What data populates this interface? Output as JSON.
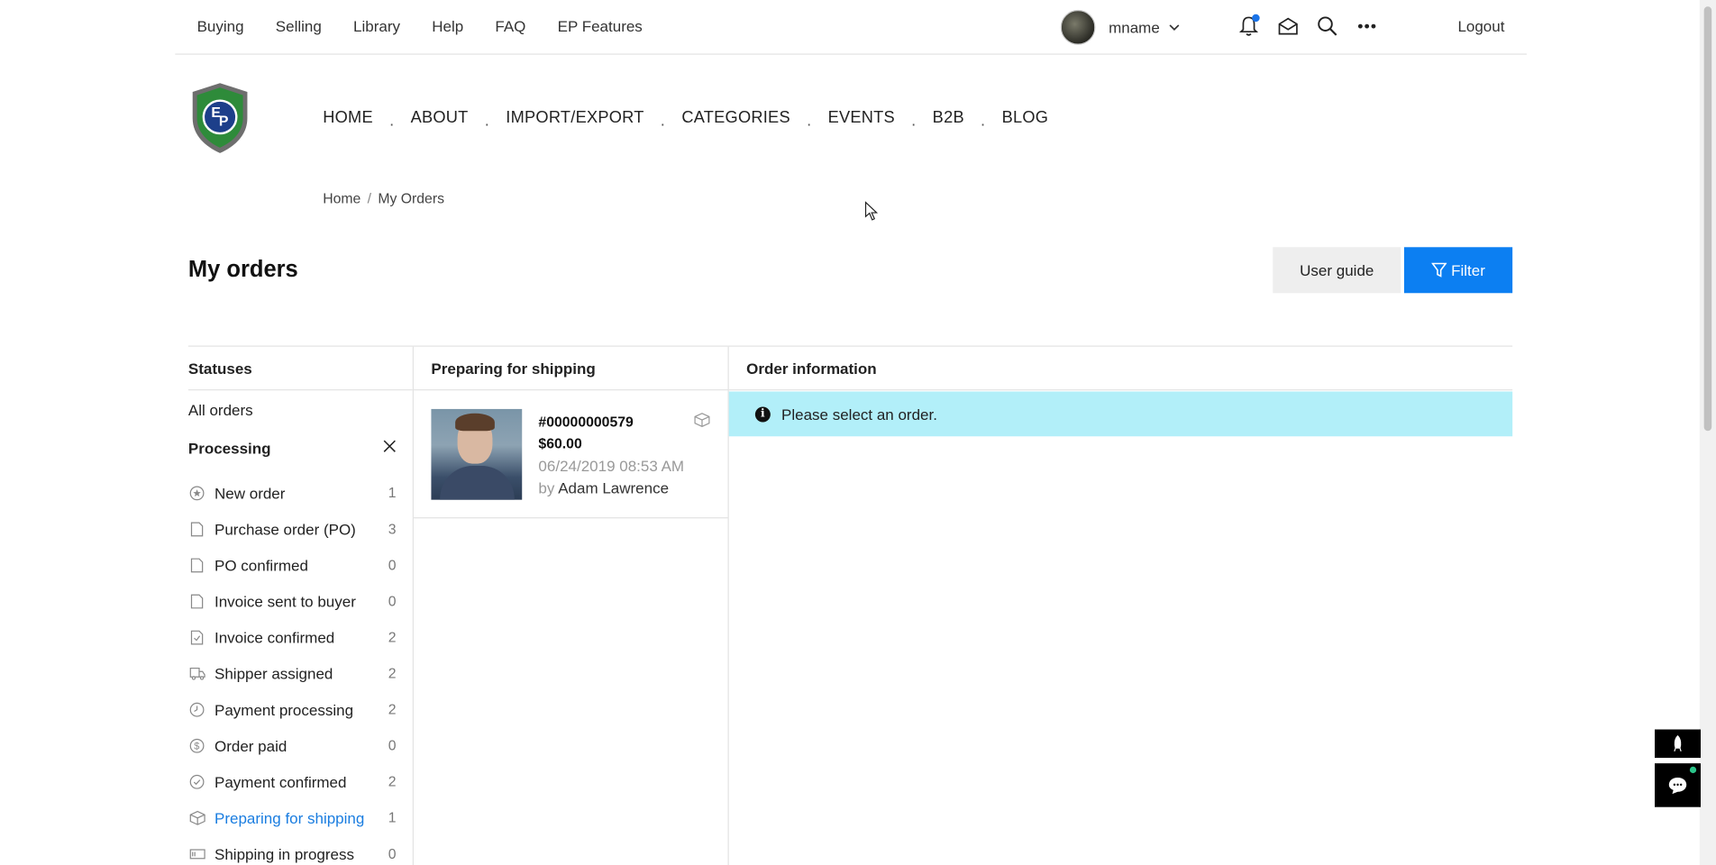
{
  "topbar": {
    "links": [
      "Buying",
      "Selling",
      "Library",
      "Help",
      "FAQ",
      "EP Features"
    ],
    "username": "mname",
    "logout": "Logout"
  },
  "nav": {
    "items": [
      "HOME",
      "ABOUT",
      "IMPORT/EXPORT",
      "CATEGORIES",
      "EVENTS",
      "B2B",
      "BLOG"
    ],
    "separator": "."
  },
  "breadcrumb": {
    "home": "Home",
    "current": "My Orders"
  },
  "page": {
    "title": "My orders",
    "user_guide": "User guide",
    "filter": "Filter"
  },
  "statuses": {
    "header": "Statuses",
    "all_orders": "All orders",
    "group": "Processing",
    "items": [
      {
        "label": "New order",
        "count": "1",
        "icon": "star-circle-icon"
      },
      {
        "label": "Purchase order (PO)",
        "count": "3",
        "icon": "document-icon"
      },
      {
        "label": "PO confirmed",
        "count": "0",
        "icon": "document-icon"
      },
      {
        "label": "Invoice sent to buyer",
        "count": "0",
        "icon": "document-icon"
      },
      {
        "label": "Invoice confirmed",
        "count": "2",
        "icon": "document-check-icon"
      },
      {
        "label": "Shipper assigned",
        "count": "2",
        "icon": "truck-icon"
      },
      {
        "label": "Payment processing",
        "count": "2",
        "icon": "clock-icon"
      },
      {
        "label": "Order paid",
        "count": "0",
        "icon": "dollar-circle-icon"
      },
      {
        "label": "Payment confirmed",
        "count": "2",
        "icon": "check-circle-icon"
      },
      {
        "label": "Preparing for shipping",
        "count": "1",
        "icon": "box-icon"
      },
      {
        "label": "Shipping in progress",
        "count": "0",
        "icon": "shipping-icon"
      }
    ],
    "active_color": "#1a7de0"
  },
  "orders": {
    "header": "Preparing for shipping",
    "list": [
      {
        "number": "#00000000579",
        "price": "$60.00",
        "date": "06/24/2019 08:53 AM",
        "by_prefix": "by",
        "buyer": "Adam Lawrence"
      }
    ]
  },
  "info": {
    "header": "Order information",
    "alert": "Please select an order.",
    "alert_color": "#b2eff9"
  },
  "colors": {
    "primary": "#0c7ff2",
    "notification_dot": "#1a73e8"
  }
}
